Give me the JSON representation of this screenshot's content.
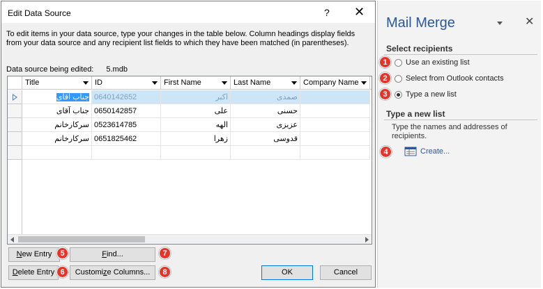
{
  "dialog": {
    "title": "Edit Data Source",
    "help_icon": "?",
    "close_icon": "✕",
    "instructions": "To edit items in your data source, type your changes in the table below. Column headings display fields from your data source and any recipient list fields to which they have been matched (in parentheses).",
    "editing_label": "Data source being edited:",
    "editing_file": "5.mdb",
    "columns": [
      "Title",
      "ID",
      "First Name",
      "Last Name",
      "Company Name"
    ],
    "rows": [
      {
        "title": "جناب آقای",
        "id": "0640142652",
        "first": "اکبر",
        "last": "صمدی"
      },
      {
        "title": "جناب آقای",
        "id": "0650142857",
        "first": "علی",
        "last": "حسنی"
      },
      {
        "title": "سرکارخانم",
        "id": "0523614785",
        "first": "الهه",
        "last": "عزیزی"
      },
      {
        "title": "سرکارخانم",
        "id": "0651825462",
        "first": "زهرا",
        "last": "قدوسی"
      }
    ],
    "buttons": {
      "new_entry_accel": "N",
      "new_entry_rest": "ew Entry",
      "find_accel": "F",
      "find_rest": "ind...",
      "delete_entry_accel": "D",
      "delete_entry_rest": "elete Entry",
      "customize_pre": "Customi",
      "customize_accel": "z",
      "customize_post": "e Columns...",
      "ok": "OK",
      "cancel": "Cancel"
    },
    "callouts": [
      "5",
      "6",
      "7",
      "8"
    ]
  },
  "pane": {
    "title": "Mail Merge",
    "close_icon": "✕",
    "select_heading": "Select recipients",
    "options": [
      "Use an existing list",
      "Select from Outlook contacts",
      "Type a new list"
    ],
    "selected_option": 2,
    "new_list_heading": "Type a new list",
    "new_list_desc": "Type the names and addresses of recipients.",
    "create_link": "Create...",
    "callouts": [
      "1",
      "2",
      "3",
      "4"
    ]
  },
  "colors": {
    "accent": "#2b579a",
    "callout": "#e8332a",
    "selection": "#3399ff"
  }
}
